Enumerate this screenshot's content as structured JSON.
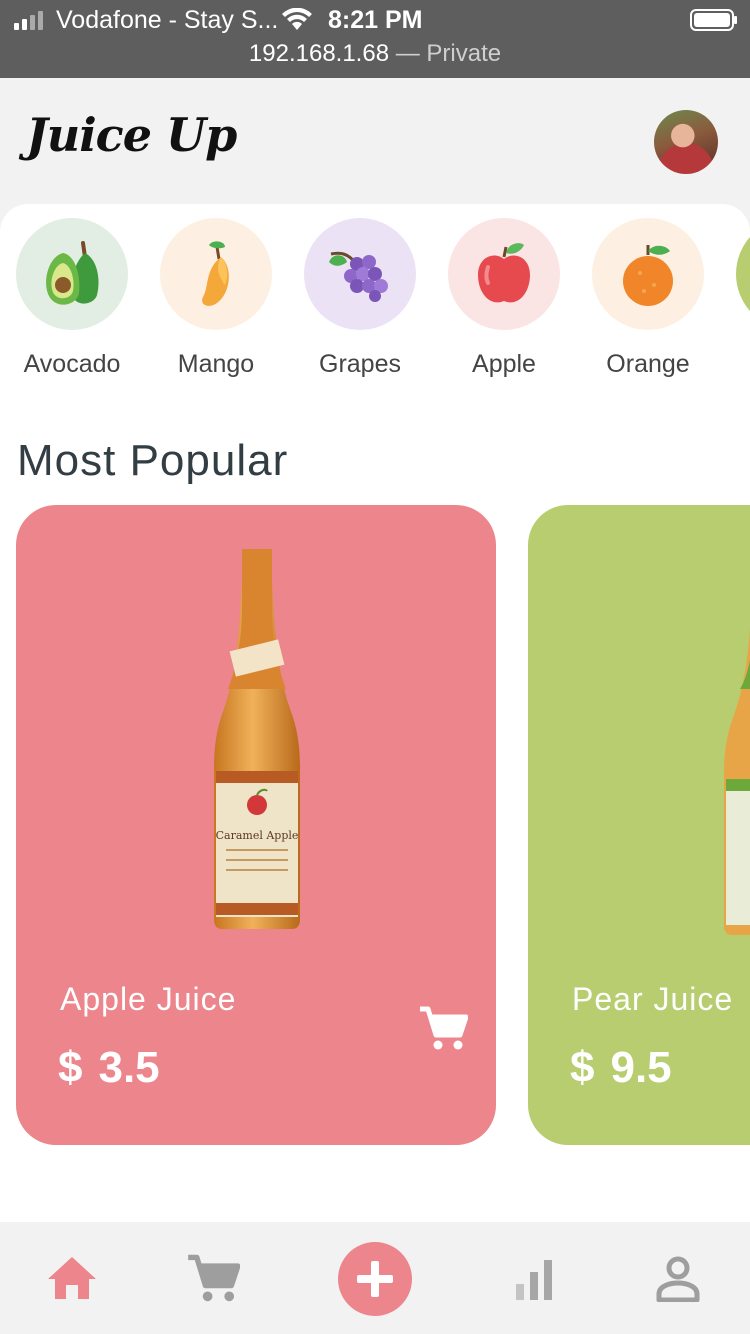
{
  "status_bar": {
    "carrier": "Vodafone - Stay S...",
    "time": "8:21 PM",
    "url_host": "192.168.1.68",
    "url_suffix": " — Private"
  },
  "header": {
    "app_title": "Juice Up",
    "avatar_icon": "user-avatar"
  },
  "categories": [
    {
      "label": "Avocado",
      "icon": "avocado-icon",
      "bg": "#e2ede3"
    },
    {
      "label": "Mango",
      "icon": "mango-icon",
      "bg": "#fdf0e2"
    },
    {
      "label": "Grapes",
      "icon": "grapes-icon",
      "bg": "#ebe3f5"
    },
    {
      "label": "Apple",
      "icon": "apple-icon",
      "bg": "#fbe4e4"
    },
    {
      "label": "Orange",
      "icon": "orange-icon",
      "bg": "#fdf0e2"
    }
  ],
  "section": {
    "title": "Most Popular"
  },
  "products": [
    {
      "name": "Apple Juice",
      "currency": "$",
      "price": "3.5",
      "color": "#ec858c",
      "bottle_label": "Caramel Apple"
    },
    {
      "name": "Pear Juice",
      "currency": "$",
      "price": "9.5",
      "color": "#b7cd6f"
    }
  ],
  "bottom_nav": [
    {
      "icon": "home-icon",
      "active": true
    },
    {
      "icon": "cart-icon",
      "active": false
    },
    {
      "icon": "add-icon",
      "active": false
    },
    {
      "icon": "stats-icon",
      "active": false
    },
    {
      "icon": "profile-icon",
      "active": false
    }
  ],
  "colors": {
    "accent": "#ec858c",
    "status_bar": "#5e5e5e",
    "nav_inactive": "#9e9e9e",
    "heading": "#333d44"
  }
}
